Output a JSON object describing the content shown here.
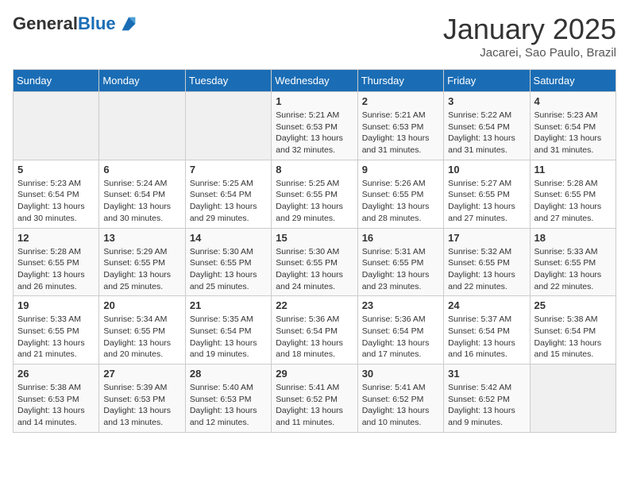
{
  "header": {
    "logo_general": "General",
    "logo_blue": "Blue",
    "title": "January 2025",
    "subtitle": "Jacarei, Sao Paulo, Brazil"
  },
  "days_of_week": [
    "Sunday",
    "Monday",
    "Tuesday",
    "Wednesday",
    "Thursday",
    "Friday",
    "Saturday"
  ],
  "weeks": [
    [
      {
        "day": "",
        "info": ""
      },
      {
        "day": "",
        "info": ""
      },
      {
        "day": "",
        "info": ""
      },
      {
        "day": "1",
        "info": "Sunrise: 5:21 AM\nSunset: 6:53 PM\nDaylight: 13 hours\nand 32 minutes."
      },
      {
        "day": "2",
        "info": "Sunrise: 5:21 AM\nSunset: 6:53 PM\nDaylight: 13 hours\nand 31 minutes."
      },
      {
        "day": "3",
        "info": "Sunrise: 5:22 AM\nSunset: 6:54 PM\nDaylight: 13 hours\nand 31 minutes."
      },
      {
        "day": "4",
        "info": "Sunrise: 5:23 AM\nSunset: 6:54 PM\nDaylight: 13 hours\nand 31 minutes."
      }
    ],
    [
      {
        "day": "5",
        "info": "Sunrise: 5:23 AM\nSunset: 6:54 PM\nDaylight: 13 hours\nand 30 minutes."
      },
      {
        "day": "6",
        "info": "Sunrise: 5:24 AM\nSunset: 6:54 PM\nDaylight: 13 hours\nand 30 minutes."
      },
      {
        "day": "7",
        "info": "Sunrise: 5:25 AM\nSunset: 6:54 PM\nDaylight: 13 hours\nand 29 minutes."
      },
      {
        "day": "8",
        "info": "Sunrise: 5:25 AM\nSunset: 6:55 PM\nDaylight: 13 hours\nand 29 minutes."
      },
      {
        "day": "9",
        "info": "Sunrise: 5:26 AM\nSunset: 6:55 PM\nDaylight: 13 hours\nand 28 minutes."
      },
      {
        "day": "10",
        "info": "Sunrise: 5:27 AM\nSunset: 6:55 PM\nDaylight: 13 hours\nand 27 minutes."
      },
      {
        "day": "11",
        "info": "Sunrise: 5:28 AM\nSunset: 6:55 PM\nDaylight: 13 hours\nand 27 minutes."
      }
    ],
    [
      {
        "day": "12",
        "info": "Sunrise: 5:28 AM\nSunset: 6:55 PM\nDaylight: 13 hours\nand 26 minutes."
      },
      {
        "day": "13",
        "info": "Sunrise: 5:29 AM\nSunset: 6:55 PM\nDaylight: 13 hours\nand 25 minutes."
      },
      {
        "day": "14",
        "info": "Sunrise: 5:30 AM\nSunset: 6:55 PM\nDaylight: 13 hours\nand 25 minutes."
      },
      {
        "day": "15",
        "info": "Sunrise: 5:30 AM\nSunset: 6:55 PM\nDaylight: 13 hours\nand 24 minutes."
      },
      {
        "day": "16",
        "info": "Sunrise: 5:31 AM\nSunset: 6:55 PM\nDaylight: 13 hours\nand 23 minutes."
      },
      {
        "day": "17",
        "info": "Sunrise: 5:32 AM\nSunset: 6:55 PM\nDaylight: 13 hours\nand 22 minutes."
      },
      {
        "day": "18",
        "info": "Sunrise: 5:33 AM\nSunset: 6:55 PM\nDaylight: 13 hours\nand 22 minutes."
      }
    ],
    [
      {
        "day": "19",
        "info": "Sunrise: 5:33 AM\nSunset: 6:55 PM\nDaylight: 13 hours\nand 21 minutes."
      },
      {
        "day": "20",
        "info": "Sunrise: 5:34 AM\nSunset: 6:55 PM\nDaylight: 13 hours\nand 20 minutes."
      },
      {
        "day": "21",
        "info": "Sunrise: 5:35 AM\nSunset: 6:54 PM\nDaylight: 13 hours\nand 19 minutes."
      },
      {
        "day": "22",
        "info": "Sunrise: 5:36 AM\nSunset: 6:54 PM\nDaylight: 13 hours\nand 18 minutes."
      },
      {
        "day": "23",
        "info": "Sunrise: 5:36 AM\nSunset: 6:54 PM\nDaylight: 13 hours\nand 17 minutes."
      },
      {
        "day": "24",
        "info": "Sunrise: 5:37 AM\nSunset: 6:54 PM\nDaylight: 13 hours\nand 16 minutes."
      },
      {
        "day": "25",
        "info": "Sunrise: 5:38 AM\nSunset: 6:54 PM\nDaylight: 13 hours\nand 15 minutes."
      }
    ],
    [
      {
        "day": "26",
        "info": "Sunrise: 5:38 AM\nSunset: 6:53 PM\nDaylight: 13 hours\nand 14 minutes."
      },
      {
        "day": "27",
        "info": "Sunrise: 5:39 AM\nSunset: 6:53 PM\nDaylight: 13 hours\nand 13 minutes."
      },
      {
        "day": "28",
        "info": "Sunrise: 5:40 AM\nSunset: 6:53 PM\nDaylight: 13 hours\nand 12 minutes."
      },
      {
        "day": "29",
        "info": "Sunrise: 5:41 AM\nSunset: 6:52 PM\nDaylight: 13 hours\nand 11 minutes."
      },
      {
        "day": "30",
        "info": "Sunrise: 5:41 AM\nSunset: 6:52 PM\nDaylight: 13 hours\nand 10 minutes."
      },
      {
        "day": "31",
        "info": "Sunrise: 5:42 AM\nSunset: 6:52 PM\nDaylight: 13 hours\nand 9 minutes."
      },
      {
        "day": "",
        "info": ""
      }
    ]
  ]
}
